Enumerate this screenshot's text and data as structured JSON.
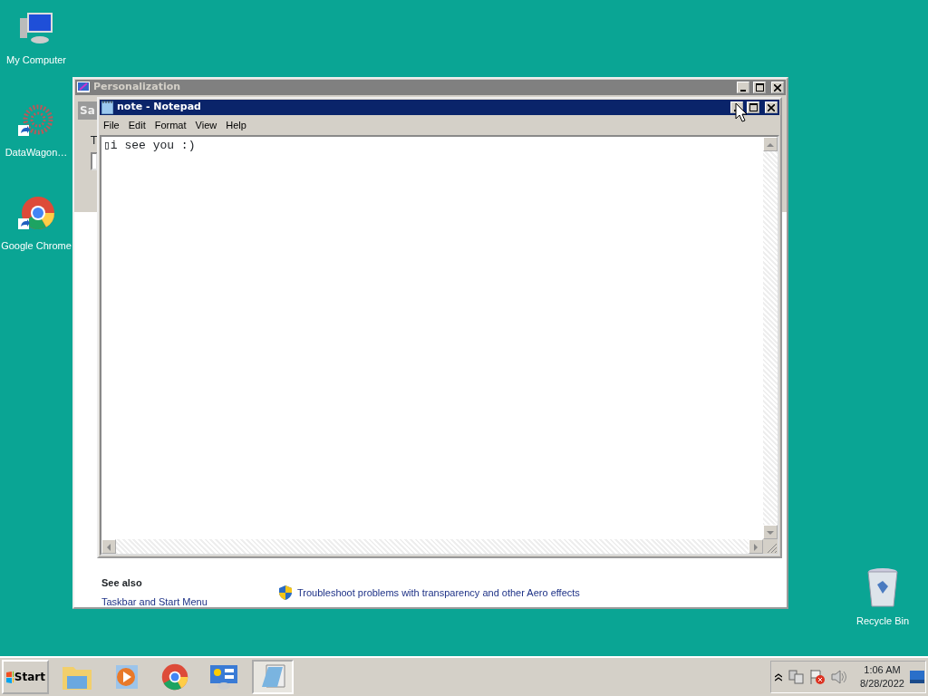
{
  "desktop_icons": [
    {
      "kind": "computer",
      "label": "My Computer"
    },
    {
      "kind": "dots",
      "label": "DataWagon…"
    },
    {
      "kind": "chrome",
      "label": "Google Chrome"
    },
    {
      "kind": "bin",
      "label": "Recycle Bin"
    }
  ],
  "personalization": {
    "title": "Personalization",
    "fragment_1": "Sa",
    "fragment_2": "T",
    "see_also": "See also",
    "link_1": "Taskbar and Start Menu",
    "link_2": "Troubleshoot problems with transparency and other Aero effects"
  },
  "notepad": {
    "title": "note - Notepad",
    "menu": [
      "File",
      "Edit",
      "Format",
      "View",
      "Help"
    ],
    "text": "▯i see you :)"
  },
  "taskbar": {
    "start": "Start",
    "buttons": [
      {
        "kind": "explorer",
        "selected": false
      },
      {
        "kind": "media",
        "selected": false
      },
      {
        "kind": "chrome",
        "selected": false
      },
      {
        "kind": "control",
        "selected": false
      },
      {
        "kind": "notepad",
        "selected": true
      }
    ],
    "time": "1:06 AM",
    "date": "8/28/2022"
  }
}
